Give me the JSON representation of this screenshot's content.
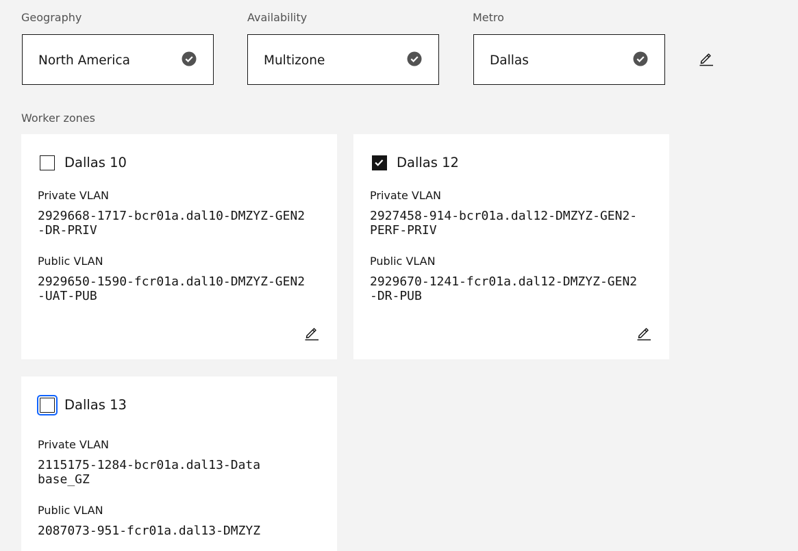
{
  "selection": {
    "geography": {
      "label": "Geography",
      "value": "North America"
    },
    "availability": {
      "label": "Availability",
      "value": "Multizone"
    },
    "metro": {
      "label": "Metro",
      "value": "Dallas"
    }
  },
  "worker_zones": {
    "label": "Worker zones",
    "zones": [
      {
        "name": "Dallas 10",
        "checked": false,
        "private_label": "Private VLAN",
        "private_vlan": "2929668-1717-bcr01a.dal10-DMZYZ-GEN2-DR-PRIV",
        "public_label": "Public VLAN",
        "public_vlan": "2929650-1590-fcr01a.dal10-DMZYZ-GEN2-UAT-PUB"
      },
      {
        "name": "Dallas 12",
        "checked": true,
        "private_label": "Private VLAN",
        "private_vlan": "2927458-914-bcr01a.dal12-DMZYZ-GEN2-PERF-PRIV",
        "public_label": "Public VLAN",
        "public_vlan": "2929670-1241-fcr01a.dal12-DMZYZ-GEN2-DR-PUB"
      },
      {
        "name": "Dallas 13",
        "checked": false,
        "focused": true,
        "private_label": "Private VLAN",
        "private_vlan": "2115175-1284-bcr01a.dal13-Database_GZ",
        "public_label": "Public VLAN",
        "public_vlan": "2087073-951-fcr01a.dal13-DMZYZ"
      }
    ]
  },
  "colors": {
    "background": "#f3f3f3",
    "tile": "#ffffff",
    "text": "#161616",
    "label": "#525252",
    "focus": "#0f62fe"
  },
  "icons": {
    "selected": "checkmark-filled-icon",
    "edit": "pencil-edit-icon",
    "checkbox_checked": "checkmark-icon"
  }
}
